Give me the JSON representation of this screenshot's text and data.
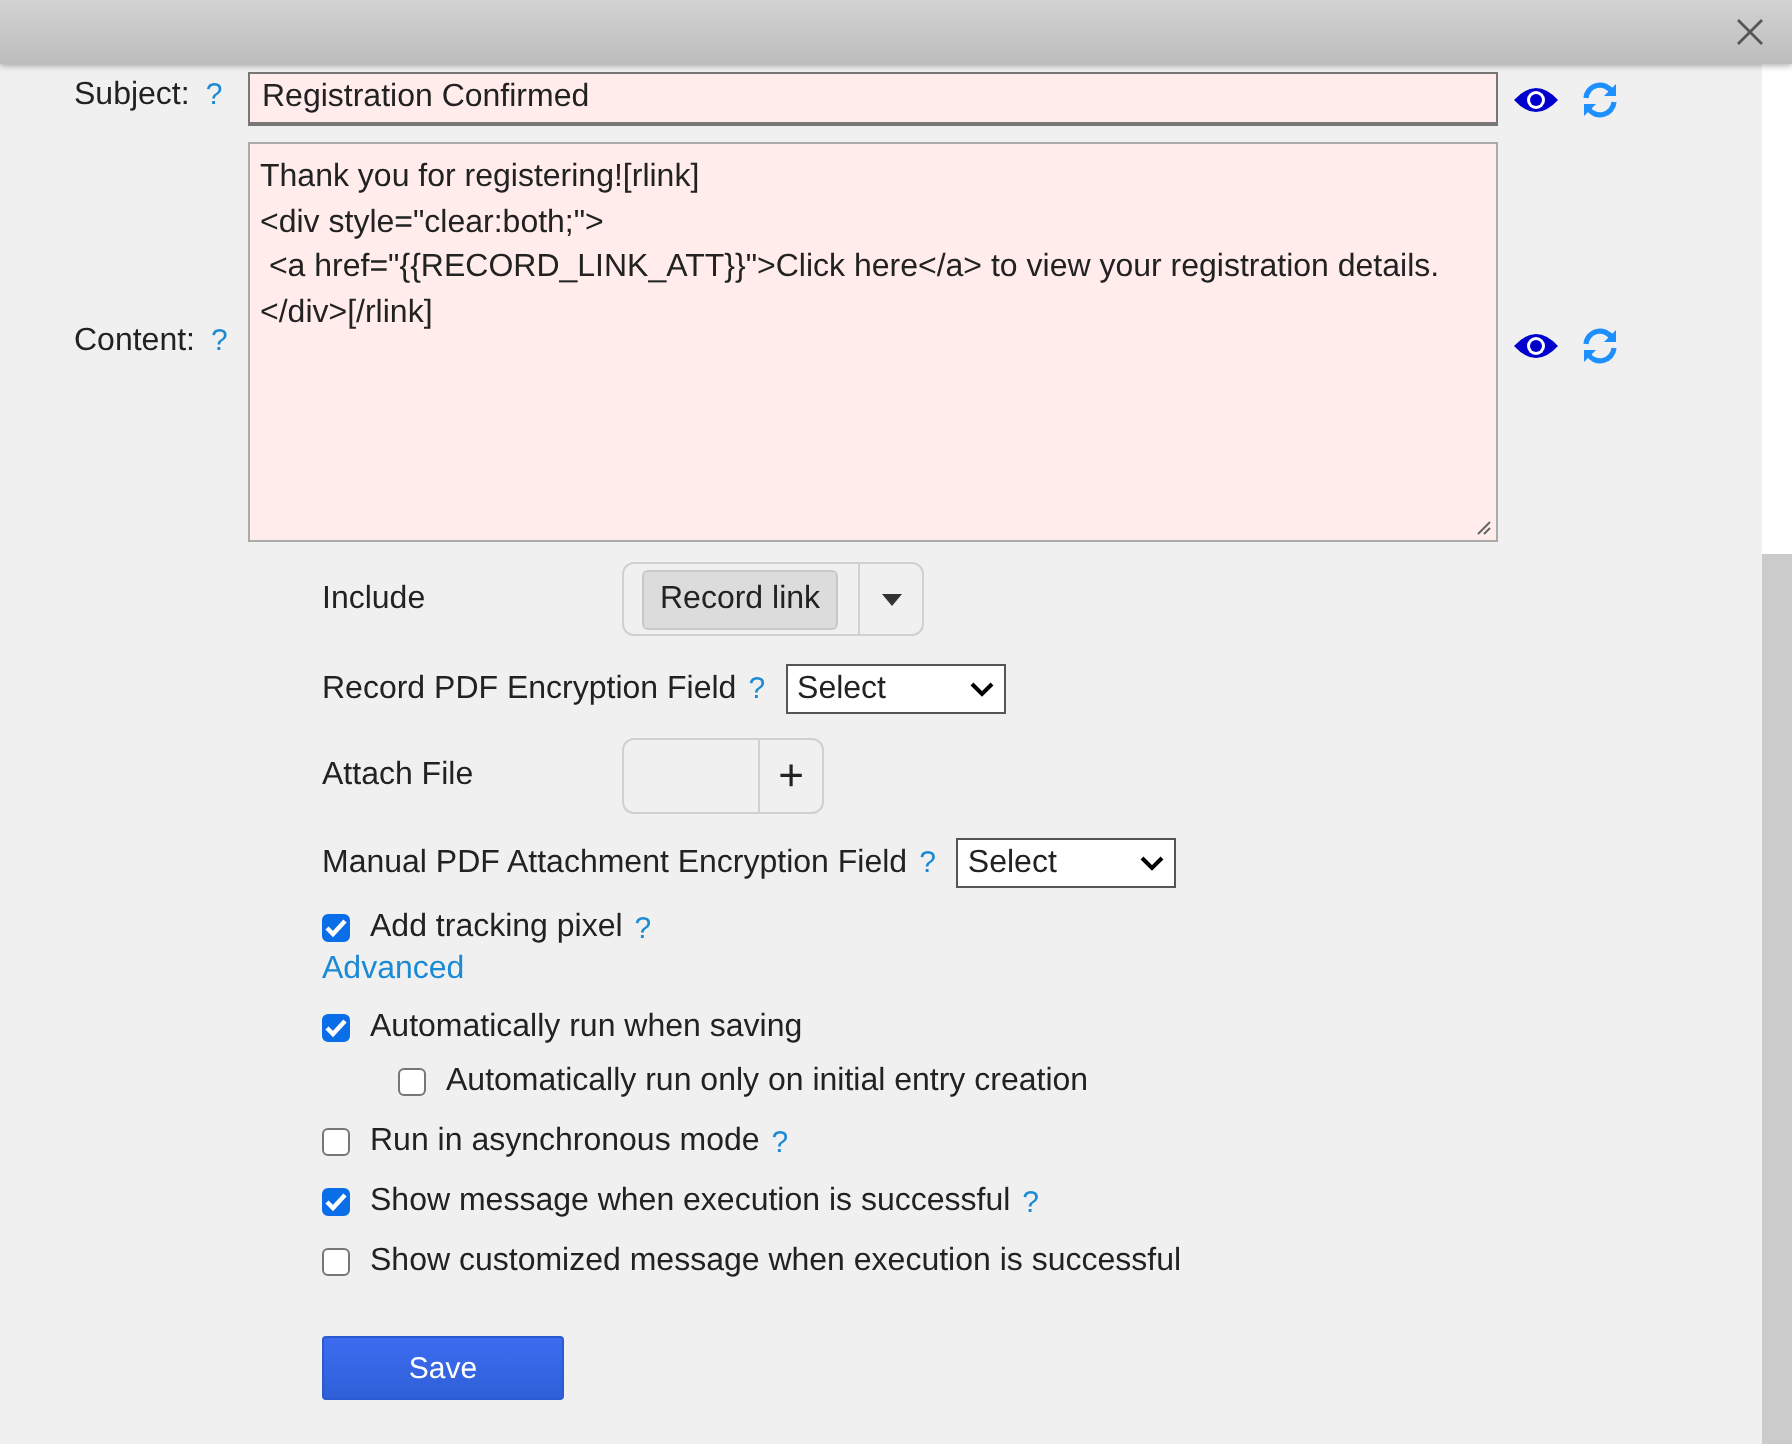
{
  "subject": {
    "label": "Subject:",
    "help": "?",
    "value": "Registration Confirmed"
  },
  "content": {
    "label": "Content:",
    "help": "?",
    "lines": [
      "Thank you for registering![rlink]",
      "<div style=\"clear:both;\">",
      " <a href=\"{{RECORD_LINK_ATT}}\">Click here</a> to view your registration details.",
      "</div>[/rlink]"
    ]
  },
  "include": {
    "label": "Include",
    "tag": "Record link"
  },
  "record_pdf_encryption": {
    "label": "Record PDF Encryption Field",
    "help": "?",
    "value": "Select"
  },
  "attach_file": {
    "label": "Attach File",
    "button": "+"
  },
  "manual_pdf_encryption": {
    "label": "Manual PDF Attachment Encryption Field",
    "help": "?",
    "value": "Select"
  },
  "tracking": {
    "label": "Add tracking pixel",
    "help": "?",
    "checked": true
  },
  "advanced_link": "Advanced",
  "options": [
    {
      "label": "Automatically run when saving",
      "checked": true,
      "children": [
        {
          "label": "Automatically run only on initial entry creation",
          "checked": false
        }
      ]
    },
    {
      "label": "Run in asynchronous mode",
      "checked": false,
      "help": "?"
    },
    {
      "label": "Show message when execution is successful",
      "checked": true,
      "help": "?"
    },
    {
      "label": "Show customized message when execution is successful",
      "checked": false
    }
  ],
  "save_button": "Save"
}
